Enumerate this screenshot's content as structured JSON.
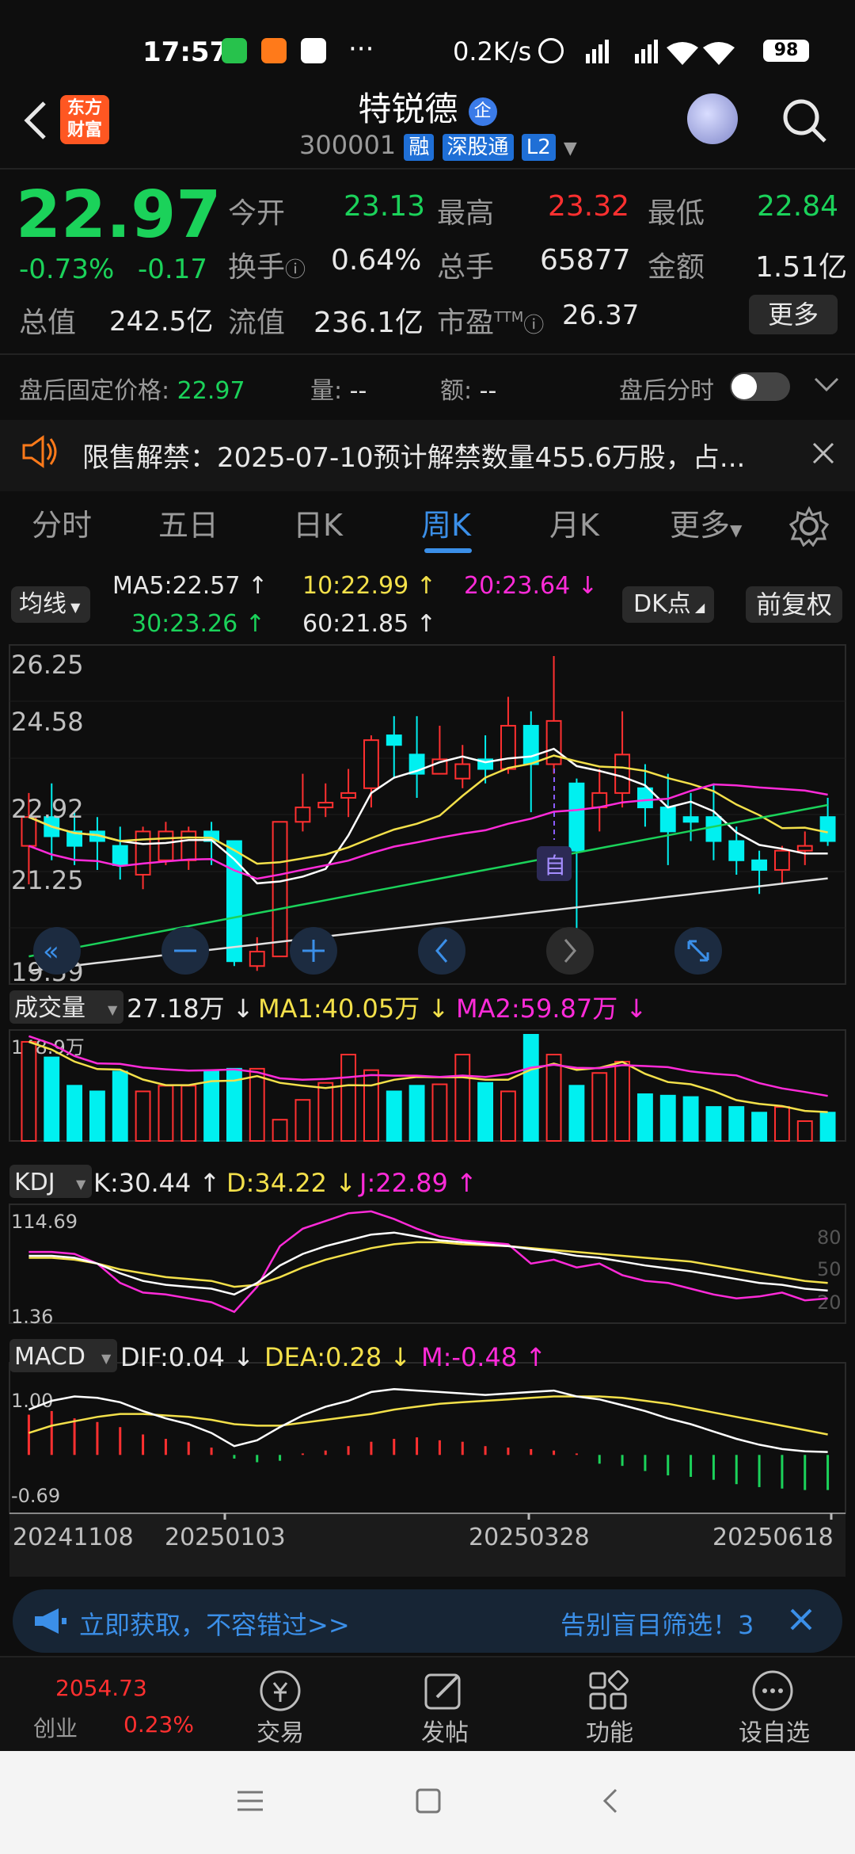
{
  "status": {
    "time": "17:57",
    "net_speed": "0.2K/s",
    "battery": "98",
    "dots": "···"
  },
  "header": {
    "logo_top": "东方",
    "logo_bottom": "财富",
    "title": "特锐德",
    "title_badge": "企",
    "code": "300001",
    "chips": [
      "融",
      "深股通",
      "L2"
    ]
  },
  "quote": {
    "price": "22.97",
    "change_pct": "-0.73%",
    "change": "-0.17",
    "open_label": "今开",
    "open": "23.13",
    "high_label": "最高",
    "high": "23.32",
    "low_label": "最低",
    "low": "22.84",
    "turnover_label": "换手",
    "turnover": "0.64%",
    "volume_label": "总手",
    "volume": "65877",
    "amount_label": "金额",
    "amount": "1.51亿",
    "mcap_label": "总值",
    "mcap": "242.5亿",
    "float_label": "流值",
    "float": "236.1亿",
    "pe_label": "市盈",
    "pe_sup": "TTM",
    "pe": "26.37",
    "more_label": "更多"
  },
  "afterhours": {
    "price_label": "盘后固定价格:",
    "price": "22.97",
    "vol_label": "量:",
    "vol": "--",
    "amt_label": "额:",
    "amt": "--",
    "toggle_label": "盘后分时"
  },
  "notice": {
    "text": "限售解禁：2025-07-10预计解禁数量455.6万股，占..."
  },
  "tabs": [
    "分时",
    "五日",
    "日K",
    "周K",
    "月K",
    "更多"
  ],
  "active_tab": "周K",
  "ma": {
    "selector": "均线",
    "ma5": "MA5:22.57",
    "ma10": "10:22.99",
    "ma20": "20:23.64",
    "ma30": "30:23.26",
    "ma60": "60:21.85",
    "dk": "DK点",
    "fq": "前复权"
  },
  "price_axis": [
    "26.25",
    "24.58",
    "22.92",
    "21.25",
    "19.59"
  ],
  "volume_panel": {
    "selector": "成交量",
    "v": "27.18万",
    "ma1": "MA1:40.05万",
    "ma2": "MA2:59.87万",
    "top": "148.9万"
  },
  "kdj_panel": {
    "selector": "KDJ",
    "k": "K:30.44",
    "d": "D:34.22",
    "j": "J:22.89",
    "top": "114.69",
    "bottom": "1.36",
    "levels": [
      "80",
      "50",
      "20"
    ]
  },
  "macd_panel": {
    "selector": "MACD",
    "dif": "DIF:0.04",
    "dea": "DEA:0.28",
    "m": "M:-0.48",
    "top": "1.00",
    "bottom": "-0.69"
  },
  "dates": [
    "20241108",
    "20250103",
    "20250328",
    "20250618"
  ],
  "zi_marker": "自",
  "ad": {
    "left": "立即获取，不容错过>>",
    "right": "告别盲目筛选！3"
  },
  "bottom_nav": {
    "index_value": "2054.73",
    "index_name": "创业",
    "index_pct": "0.23%",
    "items": [
      "交易",
      "发帖",
      "功能",
      "设自选"
    ]
  },
  "colors": {
    "up": "#ff3030",
    "down": "#00f0f0",
    "green": "#1bd25a",
    "yellow": "#f3e04a",
    "magenta": "#ff2bd9",
    "accent": "#3b8fe8"
  }
}
